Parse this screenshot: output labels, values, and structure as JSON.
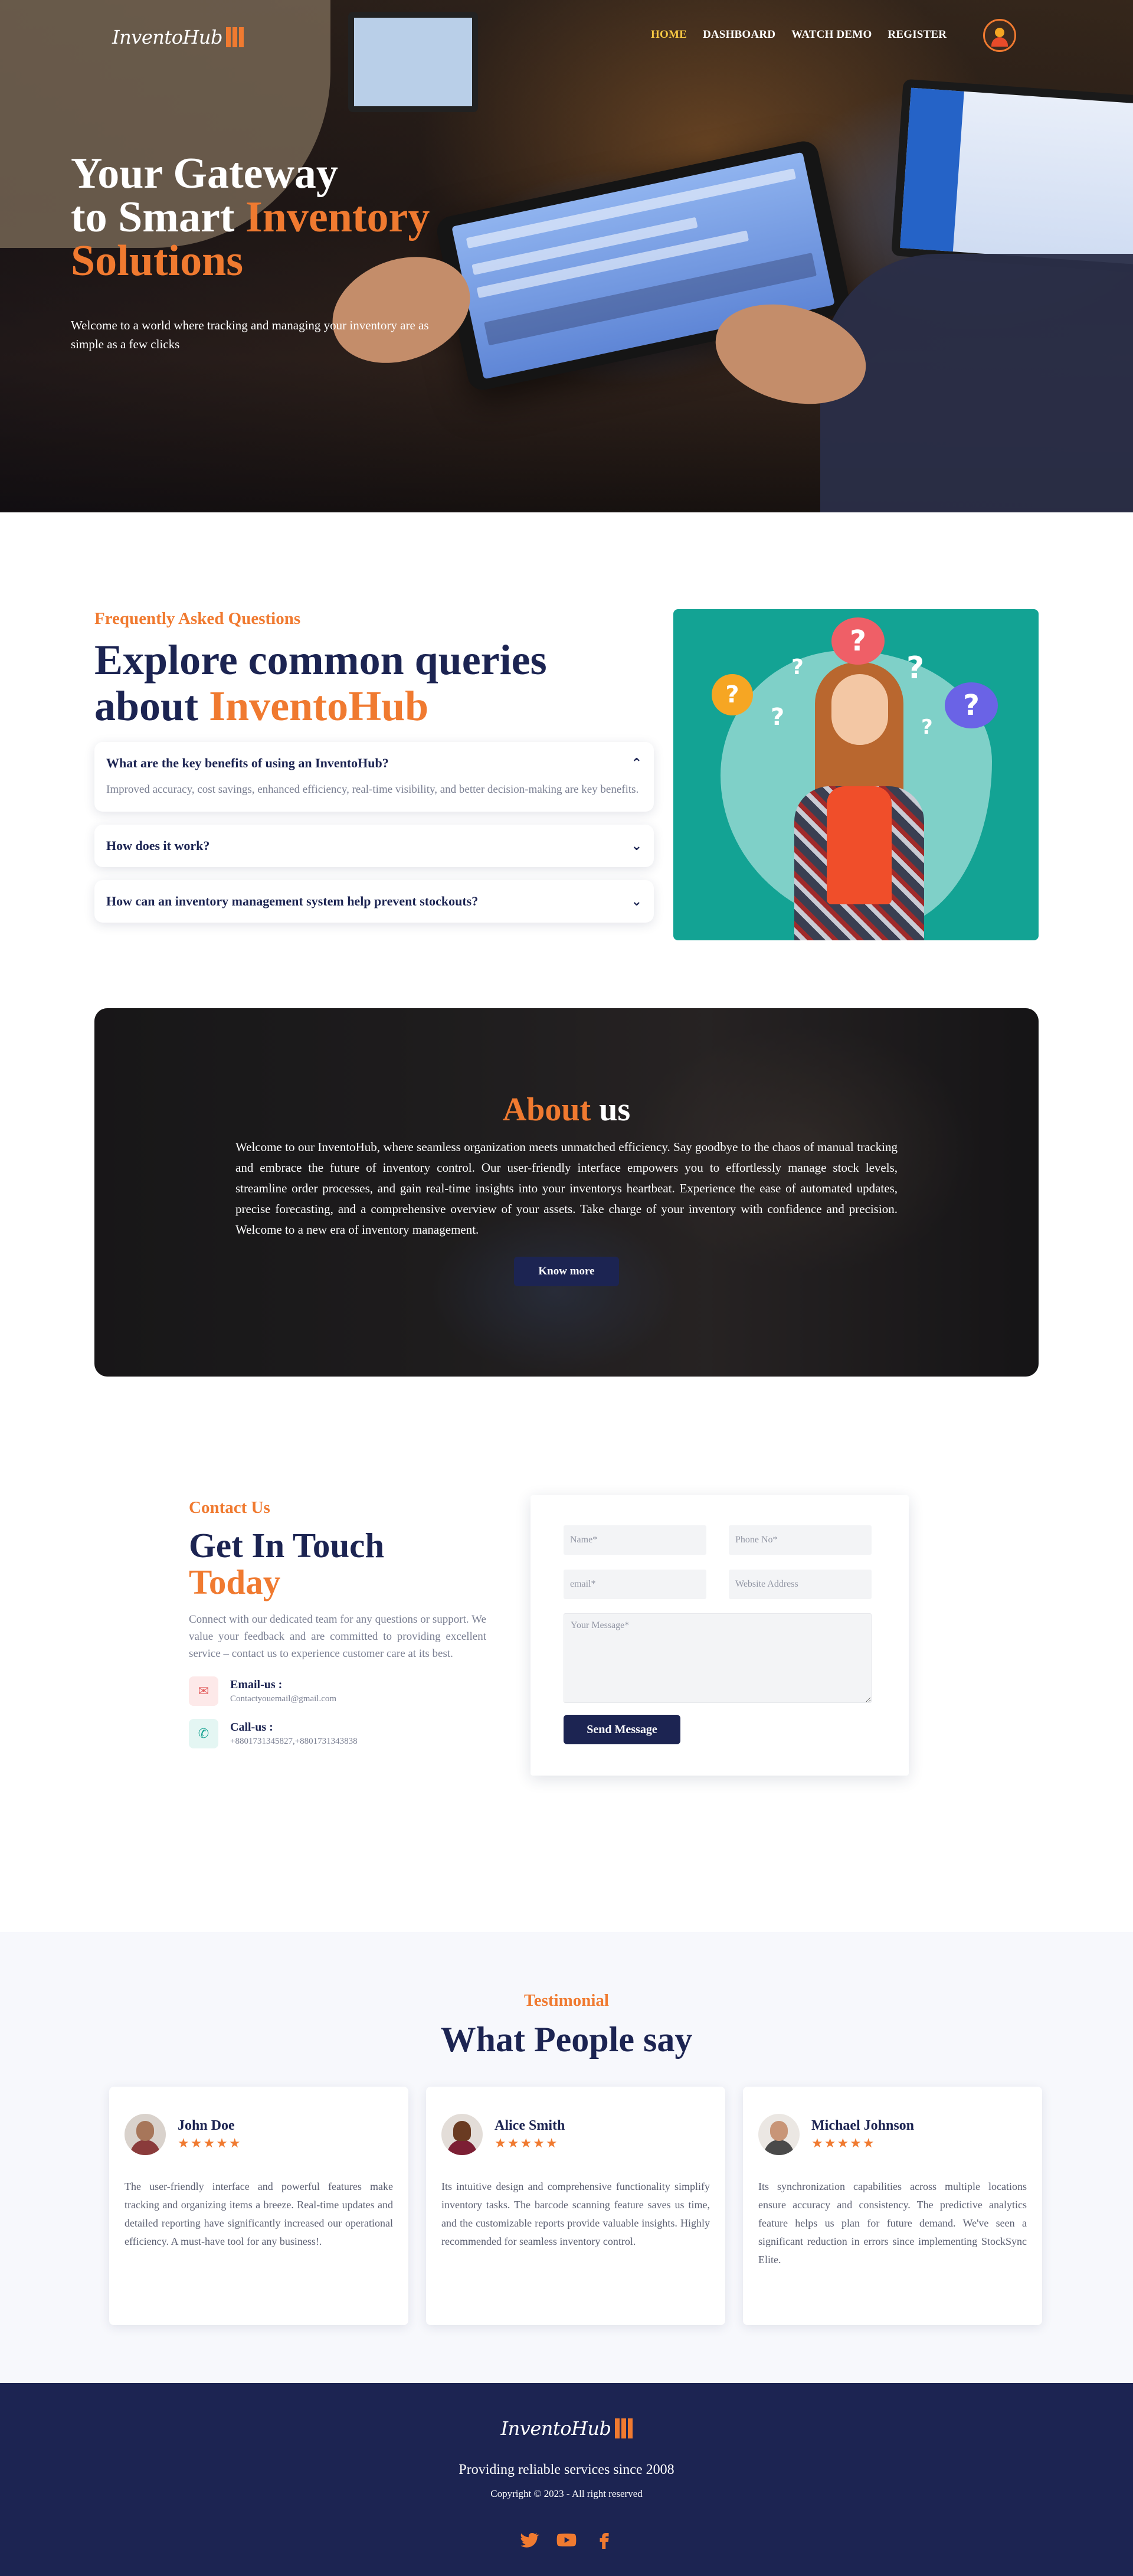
{
  "brand": {
    "name": "InventoHub",
    "accent_color": "#f07a30",
    "primary_color": "#1c2452"
  },
  "nav": {
    "links": [
      {
        "label": "Home",
        "active": true
      },
      {
        "label": "Dashboard",
        "active": false
      },
      {
        "label": "Watch Demo",
        "active": false
      },
      {
        "label": "Register",
        "active": false
      }
    ],
    "avatar_icon": "user-avatar-icon"
  },
  "hero": {
    "title_line1": "Your Gateway",
    "title_line2_plain": "to Smart ",
    "title_line2_accent": "Inventory",
    "title_line3_accent": "Solutions",
    "subtitle": "Welcome to a world where tracking and managing your inventory are as simple as a few clicks"
  },
  "faq": {
    "eyebrow": "Frequently Asked Questions",
    "title_line1": "Explore common queries",
    "title_line2_plain": "about ",
    "title_line2_accent": "InventoHub",
    "items": [
      {
        "question": "What are the key benefits of using an InventoHub?",
        "answer": "Improved accuracy, cost savings, enhanced efficiency, real-time visibility, and better decision-making are key benefits.",
        "expanded": true,
        "icon": "chevron-up-icon"
      },
      {
        "question": "How does it work?",
        "answer": "",
        "expanded": false,
        "icon": "chevron-down-icon"
      },
      {
        "question": "How can an inventory management system help prevent stockouts?",
        "answer": "",
        "expanded": false,
        "icon": "chevron-down-icon"
      }
    ],
    "illustration_bg": "#13a394"
  },
  "about": {
    "title_accent": "About",
    "title_plain": " us",
    "text": "Welcome to our InventoHub, where seamless organization meets unmatched efficiency. Say goodbye to the chaos of manual tracking and embrace the future of inventory control. Our user-friendly interface empowers you to effortlessly manage stock levels, streamline order processes, and gain real-time insights into your inventorys heartbeat. Experience the ease of automated updates, precise forecasting, and a comprehensive overview of your assets. Take charge of your inventory with confidence and precision. Welcome to a new era of inventory management.",
    "button": "Know more"
  },
  "contact": {
    "eyebrow": "Contact Us",
    "title_line1": "Get In Touch",
    "title_line2_accent": "Today",
    "description": "Connect with our dedicated team for any questions or support. We value your feedback and are committed to providing excellent service – contact us to experience customer care at its best.",
    "email_label": "Email-us :",
    "email_value": "Contactyouemail@gmail.com",
    "call_label": "Call-us :",
    "call_value": "+8801731345827,+8801731343838",
    "form": {
      "name_placeholder": "Name*",
      "phone_placeholder": "Phone No*",
      "email_placeholder": "email*",
      "website_placeholder": "Website Address",
      "message_placeholder": "Your Message*",
      "submit": "Send Message"
    }
  },
  "testimonials": {
    "eyebrow": "Testimonial",
    "title": "What People say",
    "items": [
      {
        "name": "John Doe",
        "stars": "★★★★★",
        "rating": 5,
        "text": "The user-friendly interface and powerful features make tracking and organizing items a breeze. Real-time updates and detailed reporting have significantly increased our operational efficiency. A must-have tool for any business!."
      },
      {
        "name": "Alice Smith",
        "stars": "★★★★★",
        "rating": 5,
        "text": "Its intuitive design and comprehensive functionality simplify inventory tasks. The barcode scanning feature saves us time, and the customizable reports provide valuable insights. Highly recommended for seamless inventory control."
      },
      {
        "name": "Michael Johnson",
        "stars": "★★★★★",
        "rating": 5,
        "text": "Its synchronization capabilities across multiple locations ensure accuracy and consistency. The predictive analytics feature helps us plan for future demand. We've seen a significant reduction in errors since implementing StockSync Elite."
      }
    ]
  },
  "footer": {
    "tagline": "Providing reliable services since 2008",
    "copyright": "Copyright © 2023 - All right reserved",
    "social_icons": [
      "twitter-icon",
      "youtube-icon",
      "facebook-icon"
    ]
  }
}
